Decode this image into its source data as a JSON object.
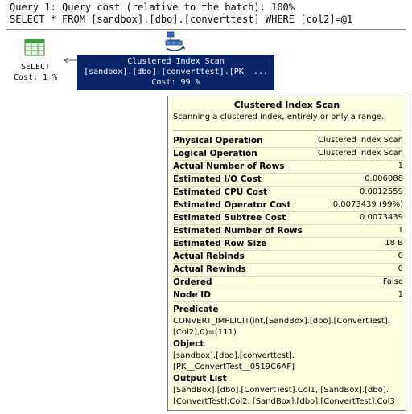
{
  "header": {
    "query_cost_line": "Query 1: Query cost (relative to the batch): 100%",
    "sql_line": "SELECT * FROM [sandbox].[dbo].[converttest] WHERE [col2]=@1"
  },
  "select_node": {
    "icon": "select-result-icon",
    "label": "SELECT",
    "cost": "Cost: 1 %"
  },
  "scan_node": {
    "icon": "clustered-index-scan-icon",
    "title": "Clustered Index Scan",
    "object": "[sandbox].[dbo].[converttest].[PK__...",
    "cost": "Cost: 99 %"
  },
  "tooltip": {
    "title": "Clustered Index Scan",
    "description": "Scanning a clustered index, entirely or only a range.",
    "properties": [
      {
        "key": "Physical Operation",
        "value": "Clustered Index Scan"
      },
      {
        "key": "Logical Operation",
        "value": "Clustered Index Scan"
      },
      {
        "key": "Actual Number of Rows",
        "value": "1"
      },
      {
        "key": "Estimated I/O Cost",
        "value": "0.006088"
      },
      {
        "key": "Estimated CPU Cost",
        "value": "0.0012559"
      },
      {
        "key": "Estimated Operator Cost",
        "value": "0.0073439 (99%)"
      },
      {
        "key": "Estimated Subtree Cost",
        "value": "0.0073439"
      },
      {
        "key": "Estimated Number of Rows",
        "value": "1"
      },
      {
        "key": "Estimated Row Size",
        "value": "18 B"
      },
      {
        "key": "Actual Rebinds",
        "value": "0"
      },
      {
        "key": "Actual Rewinds",
        "value": "0"
      },
      {
        "key": "Ordered",
        "value": "False"
      },
      {
        "key": "Node ID",
        "value": "1"
      }
    ],
    "predicate": {
      "heading": "Predicate",
      "lines": [
        "CONVERT_IMPLICIT(int,[SandBox].[dbo].[ConvertTest].",
        "[Col2],0)=(111)"
      ]
    },
    "object": {
      "heading": "Object",
      "lines": [
        "[sandbox].[dbo].[converttest].",
        "[PK__ConvertTest__0519C6AF]"
      ]
    },
    "output_list": {
      "heading": "Output List",
      "lines": [
        "[SandBox].[dbo].[ConvertTest].Col1, [SandBox].[dbo].",
        "[ConvertTest].Col2, [SandBox].[dbo].[ConvertTest].Col3"
      ]
    }
  },
  "colors": {
    "selected_node_bg": "#0a246a",
    "tooltip_bg": "#ffffe1"
  }
}
